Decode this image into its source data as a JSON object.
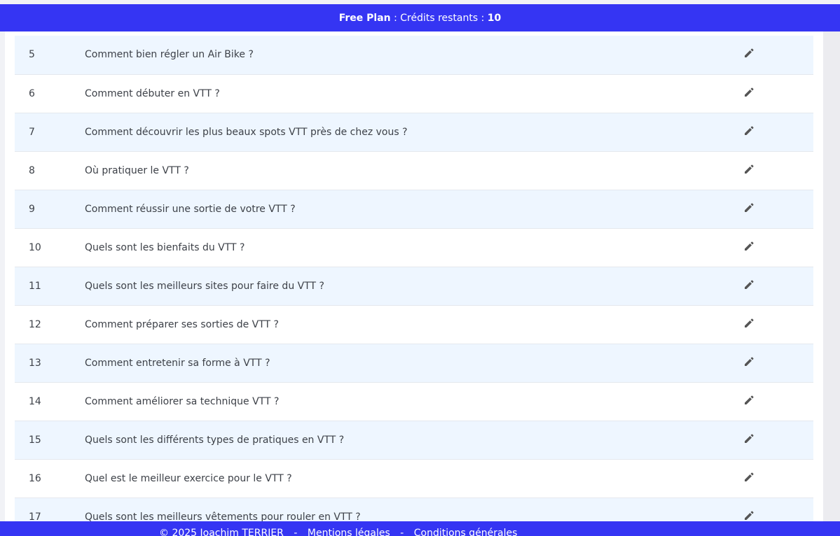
{
  "topbar": {
    "plan": "Free Plan",
    "credits_label": " : Crédits restants : ",
    "credits_value": "10"
  },
  "questions": [
    {
      "num": "5",
      "title": "Comment bien régler un Air Bike ?"
    },
    {
      "num": "6",
      "title": "Comment débuter en VTT ?"
    },
    {
      "num": "7",
      "title": "Comment découvrir les plus beaux spots VTT près de chez vous ?"
    },
    {
      "num": "8",
      "title": "Où pratiquer le VTT ?"
    },
    {
      "num": "9",
      "title": "Comment réussir une sortie de votre VTT ?"
    },
    {
      "num": "10",
      "title": "Quels sont les bienfaits du VTT ?"
    },
    {
      "num": "11",
      "title": "Quels sont les meilleurs sites pour faire du VTT ?"
    },
    {
      "num": "12",
      "title": "Comment préparer ses sorties de VTT ?"
    },
    {
      "num": "13",
      "title": "Comment entretenir sa forme à VTT ?"
    },
    {
      "num": "14",
      "title": "Comment améliorer sa technique VTT ?"
    },
    {
      "num": "15",
      "title": "Quels sont les différents types de pratiques en VTT ?"
    },
    {
      "num": "16",
      "title": "Quel est le meilleur exercice pour le VTT ?"
    },
    {
      "num": "17",
      "title": "Quels sont les meilleurs vêtements pour rouler en VTT ?"
    }
  ],
  "footer": {
    "copyright": "© 2025 Joachim TERRIER",
    "separator": "-",
    "legal": "Mentions légales",
    "terms": "Conditions générales"
  },
  "colors": {
    "brand": "#3535f3",
    "row_alt": "#eef6ff",
    "icon": "#555555"
  },
  "icons": {
    "edit": "pencil-icon"
  }
}
